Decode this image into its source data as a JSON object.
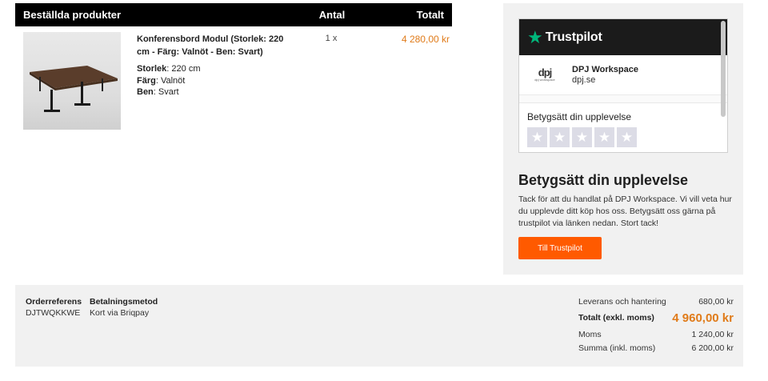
{
  "order": {
    "headers": {
      "products": "Beställda produkter",
      "qty": "Antal",
      "total": "Totalt"
    },
    "items": [
      {
        "name": "Konferensbord Modul (Storlek: 220 cm - Färg: Valnöt - Ben: Svart)",
        "specs": [
          {
            "label": "Storlek",
            "value": ": 220 cm"
          },
          {
            "label": "Färg",
            "value": ": Valnöt"
          },
          {
            "label": "Ben",
            "value": ": Svart"
          }
        ],
        "qty": "1 x",
        "price": "4 280,00 kr"
      }
    ]
  },
  "trustpilot": {
    "brand": "Trustpilot",
    "logo_mark": "dpj",
    "logo_sub": "dpj workspace",
    "company_name": "DPJ Workspace",
    "company_url": "dpj.se",
    "rate_title": "Betygsätt din upplevelse",
    "stars": [
      "★",
      "★",
      "★",
      "★",
      "★"
    ],
    "star_logo": "★"
  },
  "review": {
    "heading": "Betygsätt din upplevelse",
    "text": "Tack för att du handlat på DPJ Workspace. Vi vill veta hur du upplevde ditt köp hos oss. Betygsätt oss gärna på trustpilot via länken nedan. Stort tack!",
    "button": "Till Trustpilot"
  },
  "summary": {
    "order_ref_label": "Orderreferens",
    "order_ref_value": "DJTWQKKWE",
    "payment_label": "Betalningsmetod",
    "payment_value": "Kort via Briqpay",
    "rows": {
      "shipping_label": "Leverans och hantering",
      "shipping_value": "680,00 kr",
      "total_label": "Totalt (exkl. moms)",
      "total_value": "4 960,00 kr",
      "vat_label": "Moms",
      "vat_value": "1 240,00 kr",
      "sum_label": "Summa (inkl. moms)",
      "sum_value": "6 200,00 kr"
    }
  },
  "colors": {
    "accent": "#e07b1a",
    "button": "#ff5a00",
    "trustpilot_green": "#00b67a"
  }
}
